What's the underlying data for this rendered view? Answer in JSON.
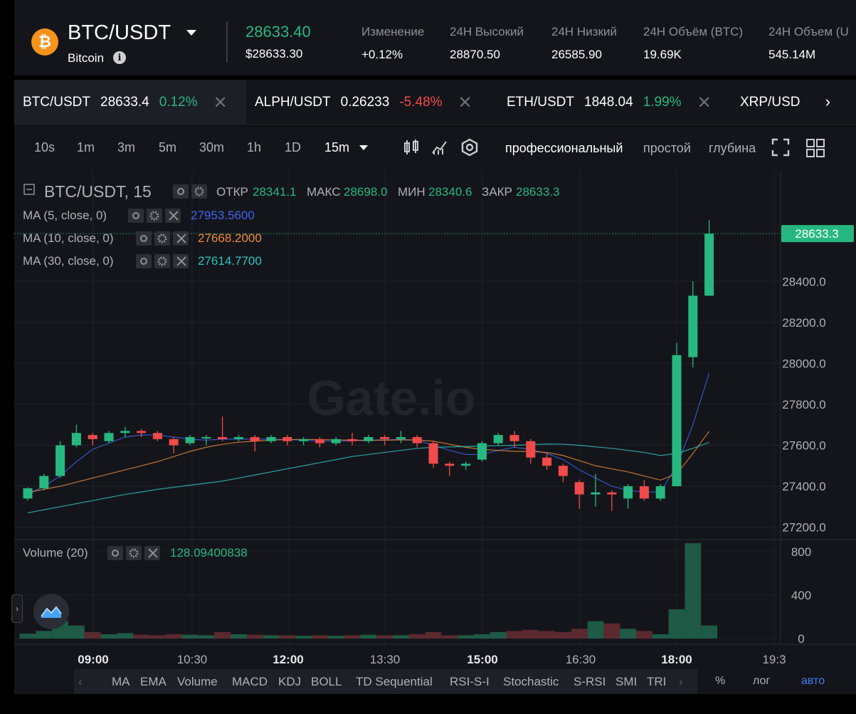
{
  "header": {
    "coin_symbol": "₿",
    "pair": "BTC/USDT",
    "coin_name": "Bitcoin",
    "last_price": "28633.40",
    "usd_price": "$28633.30",
    "stats": [
      {
        "label": "Изменение",
        "value": "+0.12%",
        "color": "#26b880"
      },
      {
        "label": "24H Высокий",
        "value": "28870.50"
      },
      {
        "label": "24H Низкий",
        "value": "26585.90"
      },
      {
        "label": "24H Объём (BTC)",
        "value": "19.69K"
      },
      {
        "label": "24H Объем (U",
        "value": "545.14M"
      }
    ]
  },
  "tabs": [
    {
      "name": "BTC/USDT",
      "price": "28633.4",
      "change": "0.12%",
      "dir": "up",
      "close": "✕"
    },
    {
      "name": "ALPH/USDT",
      "price": "0.26233",
      "change": "-5.48%",
      "dir": "dn",
      "close": "✕"
    },
    {
      "name": "ETH/USDT",
      "price": "1848.04",
      "change": "1.99%",
      "dir": "up",
      "close": "✕"
    },
    {
      "name": "XRP/USD",
      "price": "",
      "change": "",
      "dir": "",
      "close": ""
    }
  ],
  "toolbar": {
    "timeframes": [
      "10s",
      "1m",
      "3m",
      "5m",
      "30m",
      "1h",
      "1D"
    ],
    "selected_timeframe": "15m",
    "modes": [
      "профессиональный",
      "простой",
      "глубина"
    ],
    "selected_mode": "профессиональный"
  },
  "chart_legend": {
    "title": "BTC/USDT, 15",
    "open_label": "ОТКР",
    "open": "28341.1",
    "high_label": "МАКС",
    "high": "28698.0",
    "low_label": "МИН",
    "low": "28340.6",
    "close_label": "ЗАКР",
    "close": "28633.3",
    "ma": [
      {
        "label": "MA (5, close, 0)",
        "value": "27953.5600",
        "color": "#3f63f0"
      },
      {
        "label": "MA (10, close, 0)",
        "value": "27668.2000",
        "color": "#f08c3a"
      },
      {
        "label": "MA (30, close, 0)",
        "value": "27614.7700",
        "color": "#2ec4c4"
      }
    ],
    "volume_label": "Volume (20)",
    "volume_value": "128.09400838"
  },
  "watermark": "Gate.io",
  "current_price_tag": "28633.3",
  "chart_data": {
    "type": "candlestick",
    "price_axis": {
      "ticks": [
        "28400.0",
        "28200.0",
        "28000.0",
        "27800.0",
        "27600.0",
        "27400.0",
        "27200.0"
      ],
      "range": [
        27150,
        28870
      ]
    },
    "volume_axis": {
      "ticks": [
        "800",
        "400",
        "0"
      ],
      "range": [
        0,
        900
      ]
    },
    "time_ticks": [
      "09:00",
      "10:30",
      "12:00",
      "13:30",
      "15:00",
      "16:30",
      "18:00",
      "19:3"
    ],
    "colors": {
      "up": "#26b880",
      "down": "#f04a4a"
    },
    "candles": [
      [
        27340,
        27390,
        27330,
        27395,
        45
      ],
      [
        27390,
        27450,
        27380,
        27460,
        70
      ],
      [
        27450,
        27600,
        27440,
        27620,
        160
      ],
      [
        27600,
        27660,
        27590,
        27700,
        120
      ],
      [
        27650,
        27630,
        27600,
        27660,
        60
      ],
      [
        27620,
        27660,
        27610,
        27670,
        40
      ],
      [
        27660,
        27670,
        27640,
        27690,
        50
      ],
      [
        27670,
        27660,
        27640,
        27680,
        35
      ],
      [
        27660,
        27630,
        27620,
        27670,
        30
      ],
      [
        27630,
        27600,
        27560,
        27640,
        40
      ],
      [
        27610,
        27640,
        27600,
        27650,
        35
      ],
      [
        27640,
        27640,
        27600,
        27650,
        30
      ],
      [
        27640,
        27630,
        27620,
        27740,
        60
      ],
      [
        27630,
        27640,
        27620,
        27650,
        40
      ],
      [
        27640,
        27620,
        27570,
        27650,
        35
      ],
      [
        27620,
        27640,
        27610,
        27650,
        30
      ],
      [
        27640,
        27620,
        27600,
        27650,
        30
      ],
      [
        27620,
        27630,
        27600,
        27640,
        25
      ],
      [
        27630,
        27610,
        27590,
        27640,
        30
      ],
      [
        27610,
        27630,
        27600,
        27640,
        25
      ],
      [
        27630,
        27620,
        27600,
        27660,
        30
      ],
      [
        27620,
        27640,
        27610,
        27650,
        35
      ],
      [
        27640,
        27630,
        27600,
        27650,
        30
      ],
      [
        27630,
        27640,
        27610,
        27670,
        30
      ],
      [
        27640,
        27610,
        27590,
        27650,
        40
      ],
      [
        27610,
        27510,
        27490,
        27620,
        60
      ],
      [
        27510,
        27500,
        27450,
        27520,
        30
      ],
      [
        27500,
        27510,
        27480,
        27520,
        30
      ],
      [
        27530,
        27610,
        27520,
        27620,
        40
      ],
      [
        27610,
        27650,
        27600,
        27660,
        60
      ],
      [
        27650,
        27620,
        27590,
        27670,
        70
      ],
      [
        27620,
        27540,
        27510,
        27630,
        80
      ],
      [
        27540,
        27500,
        27480,
        27560,
        70
      ],
      [
        27500,
        27450,
        27420,
        27510,
        60
      ],
      [
        27420,
        27360,
        27290,
        27430,
        90
      ],
      [
        27360,
        27370,
        27300,
        27460,
        160
      ],
      [
        27370,
        27360,
        27280,
        27380,
        140
      ],
      [
        27340,
        27400,
        27290,
        27410,
        90
      ],
      [
        27400,
        27340,
        27330,
        27430,
        70
      ],
      [
        27340,
        27400,
        27330,
        27410,
        40
      ],
      [
        27400,
        28040,
        27400,
        28100,
        270
      ],
      [
        28030,
        28330,
        27980,
        28400,
        880
      ],
      [
        28330,
        28633,
        28330,
        28698,
        120
      ]
    ],
    "ma_series": {
      "ma5": [
        27360,
        27400,
        27450,
        27520,
        27580,
        27610,
        27640,
        27650,
        27650,
        27640,
        27630,
        27625,
        27630,
        27630,
        27630,
        27630,
        27628,
        27625,
        27620,
        27620,
        27622,
        27625,
        27626,
        27628,
        27625,
        27600,
        27575,
        27555,
        27555,
        27575,
        27590,
        27580,
        27560,
        27530,
        27480,
        27440,
        27400,
        27380,
        27372,
        27372,
        27500,
        27700,
        27953
      ],
      "ma10": [
        27370,
        27385,
        27400,
        27420,
        27440,
        27460,
        27480,
        27500,
        27520,
        27545,
        27570,
        27590,
        27605,
        27615,
        27620,
        27625,
        27628,
        27628,
        27628,
        27626,
        27625,
        27624,
        27625,
        27626,
        27626,
        27620,
        27605,
        27590,
        27580,
        27575,
        27570,
        27570,
        27565,
        27550,
        27525,
        27500,
        27485,
        27470,
        27450,
        27430,
        27460,
        27560,
        27668
      ],
      "ma30": [
        27270,
        27285,
        27300,
        27315,
        27330,
        27345,
        27360,
        27372,
        27385,
        27395,
        27405,
        27415,
        27425,
        27440,
        27455,
        27470,
        27485,
        27500,
        27515,
        27530,
        27545,
        27555,
        27565,
        27575,
        27585,
        27590,
        27592,
        27594,
        27596,
        27598,
        27600,
        27603,
        27606,
        27605,
        27600,
        27592,
        27585,
        27575,
        27565,
        27550,
        27560,
        27585,
        27614
      ]
    }
  },
  "indicators": [
    "MA",
    "EMA",
    "Volume",
    "MACD",
    "KDJ",
    "BOLL",
    "TD Sequential",
    "RSI-S-I",
    "Stochastic",
    "S-RSI",
    "SMI",
    "TRI"
  ],
  "bottom_buttons": {
    "percent": "%",
    "log": "лог",
    "auto": "авто"
  }
}
